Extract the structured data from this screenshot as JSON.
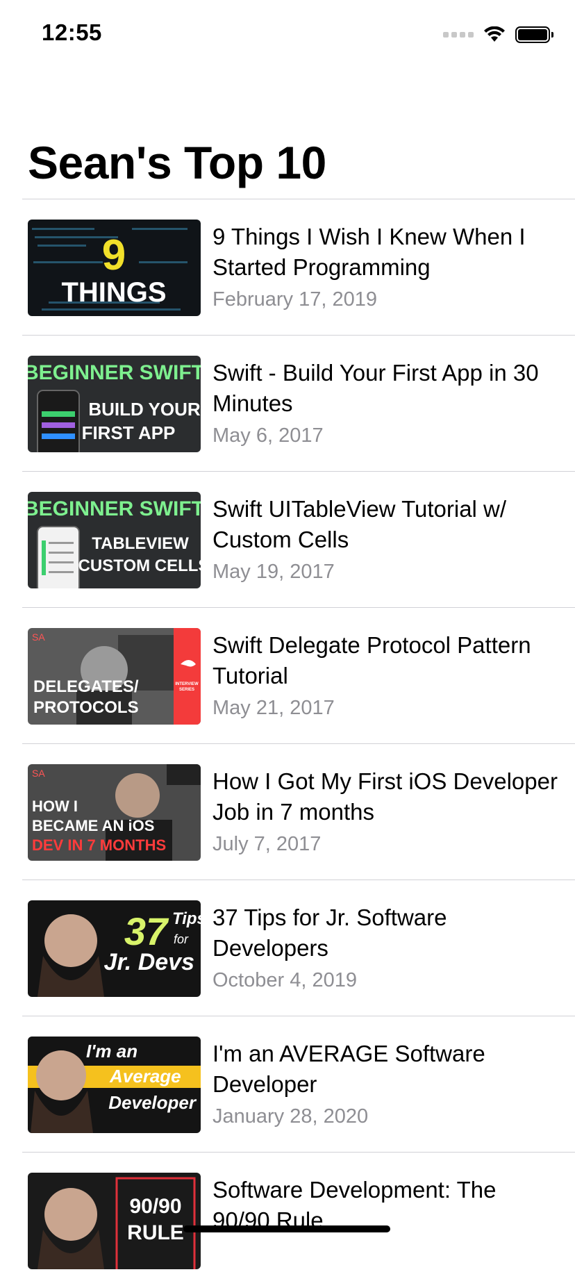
{
  "status_bar": {
    "time": "12:55",
    "battery_level": 1.0
  },
  "nav": {
    "title": "Sean's Top 10"
  },
  "videos": [
    {
      "title": "9 Things I Wish I Knew When I Started Programming",
      "date": "February 17, 2019",
      "thumb_lines": [
        "9",
        "THINGS"
      ]
    },
    {
      "title": "Swift - Build Your First App in 30 Minutes",
      "date": "May 6, 2017",
      "thumb_lines": [
        "BEGINNER SWIFT",
        "BUILD YOUR",
        "FIRST APP"
      ]
    },
    {
      "title": "Swift UITableView Tutorial w/ Custom Cells",
      "date": "May 19, 2017",
      "thumb_lines": [
        "BEGINNER SWIFT",
        "TABLEVIEW",
        "CUSTOM CELLS"
      ]
    },
    {
      "title": "Swift Delegate Protocol Pattern Tutorial",
      "date": "May 21, 2017",
      "thumb_lines": [
        "SA",
        "DELEGATES/",
        "PROTOCOLS",
        "INTERVIEW",
        "SERIES"
      ]
    },
    {
      "title": "How I Got My First iOS Developer Job in 7 months",
      "date": "July 7, 2017",
      "thumb_lines": [
        "SA",
        "HOW I",
        "BECAME AN iOS",
        "DEV IN 7 MONTHS"
      ]
    },
    {
      "title": "37 Tips for Jr. Software Developers",
      "date": "October 4, 2019",
      "thumb_lines": [
        "37",
        "Tips",
        "for",
        "Jr. Devs"
      ]
    },
    {
      "title": "I'm an AVERAGE Software Developer",
      "date": "January 28, 2020",
      "thumb_lines": [
        "I'm an",
        "Average",
        "Developer"
      ]
    },
    {
      "title": "Software Development: The 90/90 Rule",
      "date": "",
      "thumb_lines": [
        "90/90",
        "RULE"
      ]
    }
  ]
}
